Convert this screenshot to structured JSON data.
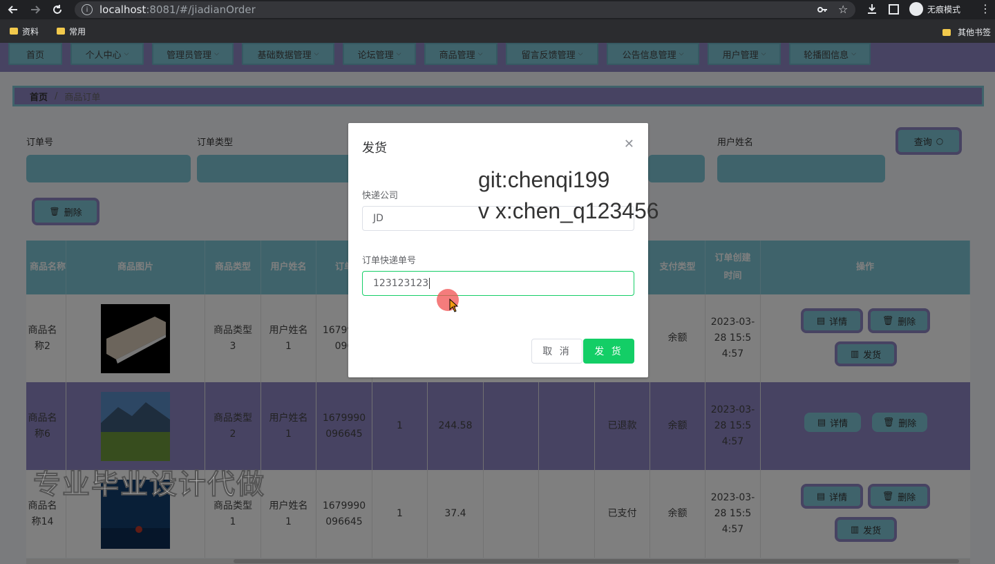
{
  "browser": {
    "url_host": "localhost",
    "url_rest": ":8081/#/jiadianOrder",
    "incognito_label": "无痕模式",
    "bookmarks": [
      "资料",
      "常用"
    ],
    "other_bookmarks": "其他书签"
  },
  "nav": {
    "items": [
      {
        "label": "首页",
        "has_menu": false
      },
      {
        "label": "个人中心",
        "has_menu": true
      },
      {
        "label": "管理员管理",
        "has_menu": true
      },
      {
        "label": "基础数据管理",
        "has_menu": true
      },
      {
        "label": "论坛管理",
        "has_menu": true
      },
      {
        "label": "商品管理",
        "has_menu": true
      },
      {
        "label": "留言反馈管理",
        "has_menu": true
      },
      {
        "label": "公告信息管理",
        "has_menu": true
      },
      {
        "label": "用户管理",
        "has_menu": true
      },
      {
        "label": "轮播图信息",
        "has_menu": true
      }
    ]
  },
  "breadcrumb": {
    "home": "首页",
    "separator": "/",
    "current": "商品订单"
  },
  "search": {
    "order_no_label": "订单号",
    "order_type_label": "订单类型",
    "user_name_label": "用户姓名",
    "query_button": "查询"
  },
  "toolbar": {
    "delete_label": "删除"
  },
  "table": {
    "headers": {
      "product_name": "商品名称",
      "product_image": "商品图片",
      "product_type": "商品类型",
      "user_name": "用户姓名",
      "order_no": "订单",
      "pay_type": "支付类型",
      "created_time": "订单创建时间",
      "actions": "操作"
    },
    "rows": [
      {
        "name": "商品名称2",
        "type": "商品类型3",
        "user": "用户姓名1",
        "order_no": "1679990096",
        "qty": "",
        "price": "",
        "status": "",
        "pay_type": "余额",
        "created": "2023-03-28 15:54:57",
        "image": "air-conditioner",
        "can_ship": true
      },
      {
        "name": "商品名称6",
        "type": "商品类型2",
        "user": "用户姓名1",
        "order_no": "1679990096645",
        "qty": "1",
        "price": "244.58",
        "status": "已退款",
        "pay_type": "余额",
        "created": "2023-03-28 15:54:57",
        "image": "mountain-meadow",
        "can_ship": false
      },
      {
        "name": "商品名称14",
        "type": "商品类型1",
        "user": "用户姓名1",
        "order_no": "1679990096645",
        "qty": "1",
        "price": "37.4",
        "status": "已支付",
        "pay_type": "余额",
        "created": "2023-03-28 15:54:57",
        "image": "ocean-poster",
        "can_ship": true
      }
    ],
    "detail_label": "详情",
    "delete_label": "删除",
    "ship_label": "发货"
  },
  "dialog": {
    "title": "发货",
    "courier_label": "快递公司",
    "courier_value": "JD",
    "tracking_label": "订单快递单号",
    "tracking_value": "123123123",
    "cancel_label": "取 消",
    "confirm_label": "发 货"
  },
  "overlay": {
    "line1": "git:chenqi199",
    "line2": "v x:chen_q123456",
    "watermark": "专业毕业设计代做"
  },
  "colors": {
    "accent_purple": "#8f86c5",
    "accent_cyan": "#7fc6d6",
    "confirm_green": "#13ce66"
  }
}
